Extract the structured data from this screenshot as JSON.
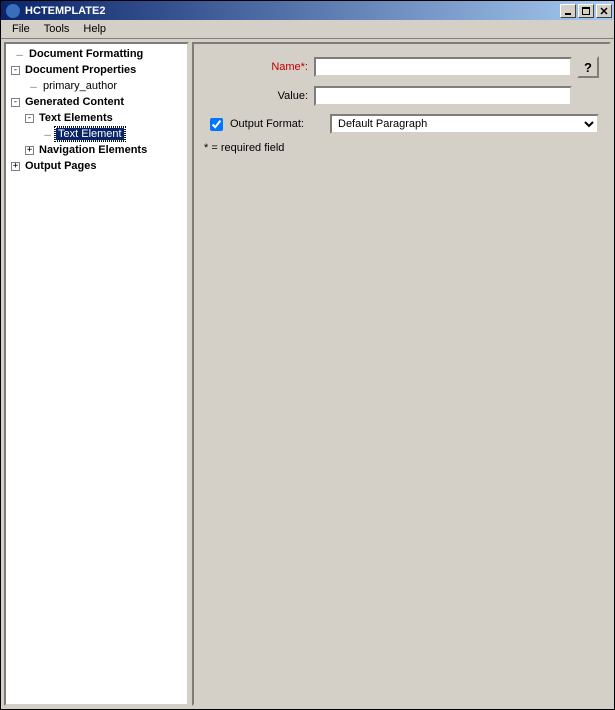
{
  "window": {
    "title": "HCTEMPLATE2"
  },
  "menu": {
    "file": "File",
    "tools": "Tools",
    "help": "Help"
  },
  "tree": {
    "docFormatting": "Document Formatting",
    "docProperties": "Document Properties",
    "primaryAuthor": "primary_author",
    "generatedContent": "Generated Content",
    "textElements": "Text Elements",
    "textElement": "Text Element",
    "navElements": "Navigation Elements",
    "outputPages": "Output Pages"
  },
  "form": {
    "nameLabel": "Name*:",
    "nameValue": "",
    "valueLabel": "Value:",
    "valueValue": "",
    "outputFormatLabel": "Output Format:",
    "outputFormatChecked": true,
    "outputFormatSelected": "Default Paragraph",
    "helpText": "?",
    "requiredNote": "* = required field"
  },
  "toggles": {
    "minus": "-",
    "plus": "+"
  }
}
